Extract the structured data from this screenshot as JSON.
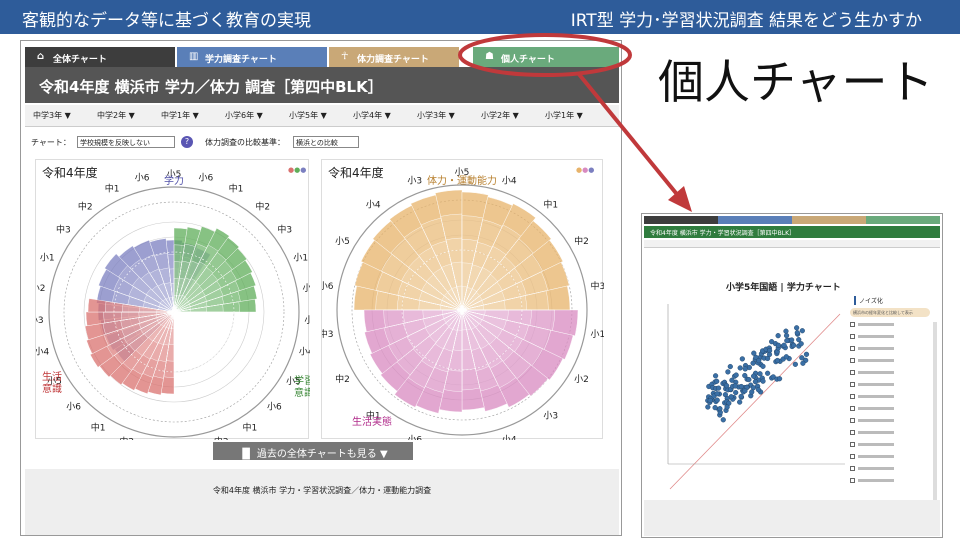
{
  "header": {
    "left": "客観的なデータ等に基づく教育の実現",
    "right": "IRT型 学力･学習状況調査 結果をどう生かすか"
  },
  "tabs": [
    {
      "label": "全体チャート",
      "color": "#3d3d3d",
      "icon": "house-icon"
    },
    {
      "label": "学力調査チャート",
      "color": "#5a7fb8",
      "icon": "book-icon"
    },
    {
      "label": "体力調査チャート",
      "color": "#c9a877",
      "icon": "runner-icon"
    },
    {
      "label": "個人チャート",
      "color": "#6aaa7c",
      "icon": "person-icon"
    }
  ],
  "title": "令和4年度 横浜市 学力／体力 調査［第四中BLK］",
  "grades": [
    "中学3年 ▼",
    "中学2年 ▼",
    "中学1年 ▼",
    "小学6年 ▼",
    "小学5年 ▼",
    "小学4年 ▼",
    "小学3年 ▼",
    "小学2年 ▼",
    "小学1年 ▼"
  ],
  "controls": {
    "chart_label": "チャート：",
    "chart_select": "学校規模を反映しない",
    "compare_label": "体力調査の比較基準：",
    "compare_select": "横浜との比較",
    "help": "?"
  },
  "left_panel": {
    "year": "令和4年度",
    "top_label": "学力",
    "left_label": "生活\n意識",
    "right_label": "学習\n意識",
    "grade_labels": [
      "小5",
      "小6",
      "中1",
      "中2",
      "中3",
      "小1",
      "小2",
      "小3",
      "小4",
      "小5",
      "小6",
      "中1",
      "中2",
      "中3",
      "中3",
      "中2",
      "中1",
      "小6",
      "小5",
      "小4",
      "小3",
      "小2",
      "小1",
      "中3",
      "中2",
      "中1",
      "小6"
    ]
  },
  "right_panel": {
    "year": "令和4年度",
    "top_label": "体力・運動能力",
    "bottom_label": "生活実態",
    "grade_labels": [
      "小5",
      "小4",
      "中1",
      "中2",
      "中3",
      "小1",
      "小2",
      "小3",
      "小4",
      "小5",
      "小6",
      "中1",
      "中2",
      "中3",
      "小6",
      "小5",
      "小4",
      "小3"
    ]
  },
  "more_button": "過去の全体チャートも見る ▼",
  "footer": "令和4年度 横浜市 学力・学習状況調査／体力・運動能力調査",
  "callout": "個人チャート",
  "thumbnail": {
    "chart_title": "小学5年国語 | 学力チャート",
    "title": "令和4年度 横浜市 学力・学習状況調査［第四中BLK］",
    "legend_title": "ノイズ化",
    "legend_box": "横浜市の経年変化と比較して表示"
  },
  "colors": {
    "blue": "#7b7fc0",
    "green": "#5fae5a",
    "red": "#d9716f",
    "gold": "#e7b36a",
    "pink": "#d88ac0",
    "accent_red": "#c0393b",
    "header_blue": "#2e5c9a"
  }
}
